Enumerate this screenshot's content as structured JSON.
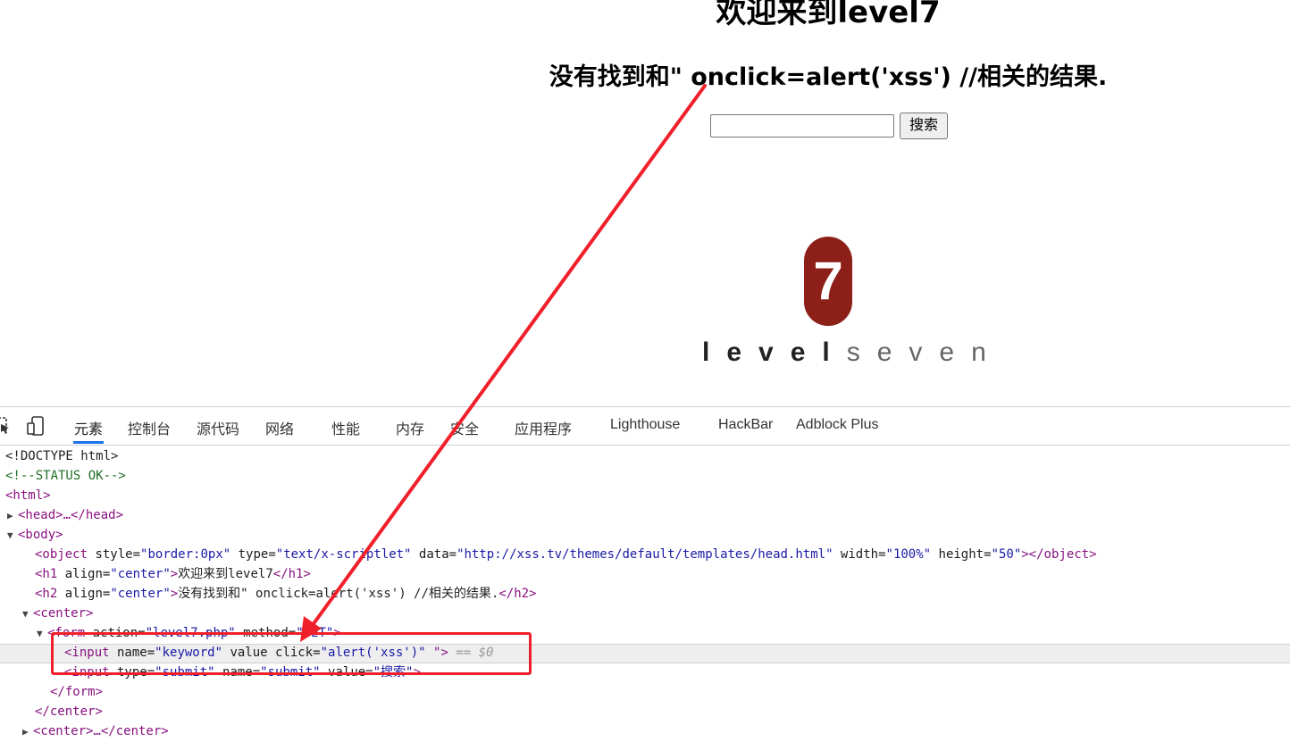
{
  "page": {
    "h1": "欢迎来到level7",
    "h2": "没有找到和\" onclick=alert('xss') //相关的结果.",
    "search_value": "",
    "search_button": "搜索",
    "logo_number": "7",
    "logo_text_bold": "level",
    "logo_text_light": "seven",
    "logo_color": "#8c2018"
  },
  "devtools": {
    "tabs": [
      "元素",
      "控制台",
      "源代码",
      "网络",
      "性能",
      "内存",
      "安全",
      "应用程序",
      "Lighthouse",
      "HackBar",
      "Adblock Plus"
    ],
    "active_tab": "元素",
    "tree": {
      "doctype": "<!DOCTYPE html>",
      "comment": "<!--STATUS OK-->",
      "html_open": "<html>",
      "head": "<head>…</head>",
      "body_open": "<body>",
      "object_line": {
        "tag_open": "<object",
        "a1n": " style=",
        "a1v": "\"border:0px\"",
        "a2n": " type=",
        "a2v": "\"text/x-scriptlet\"",
        "a3n": " data=",
        "a3v": "\"http://xss.tv/themes/default/templates/head.html\"",
        "a4n": " width=",
        "a4v": "\"100%\"",
        "a5n": " height=",
        "a5v": "\"50\"",
        "tag_close": "></object>"
      },
      "h1_line": {
        "tag_open": "<h1",
        "an": " align=",
        "av": "\"center\"",
        "gt": ">",
        "text": "欢迎来到level7",
        "close": "</h1>"
      },
      "h2_line": {
        "tag_open": "<h2",
        "an": " align=",
        "av": "\"center\"",
        "gt": ">",
        "text": "没有找到和\" onclick=alert('xss') //相关的结果.",
        "close": "</h2>"
      },
      "center_open": "<center>",
      "form_line": {
        "tag_open": "<form",
        "a1n": " action=",
        "a1v": "\"level7.php\"",
        "a2n": " method=",
        "a2v": "\"GET\"",
        "gt": ">"
      },
      "input1_line": {
        "tag_open": "<input",
        "a1n": " name=",
        "a1v": "\"keyword\"",
        "a2n": " value click=",
        "a2v": "\"alert('xss')\"",
        "rest": " \">",
        "marker": " == $0"
      },
      "input2_line": {
        "tag_open": "<input",
        "a1n": " type=",
        "a1v": "\"submit\"",
        "a2n": " name=",
        "a2v": "\"submit\"",
        "a3n": " value=",
        "a3v": "\"搜索\"",
        "gt": ">"
      },
      "form_close": "</form>",
      "center_close": "</center>",
      "center2": "<center>…</center>"
    }
  },
  "annotation": {
    "color": "#f0202a"
  }
}
